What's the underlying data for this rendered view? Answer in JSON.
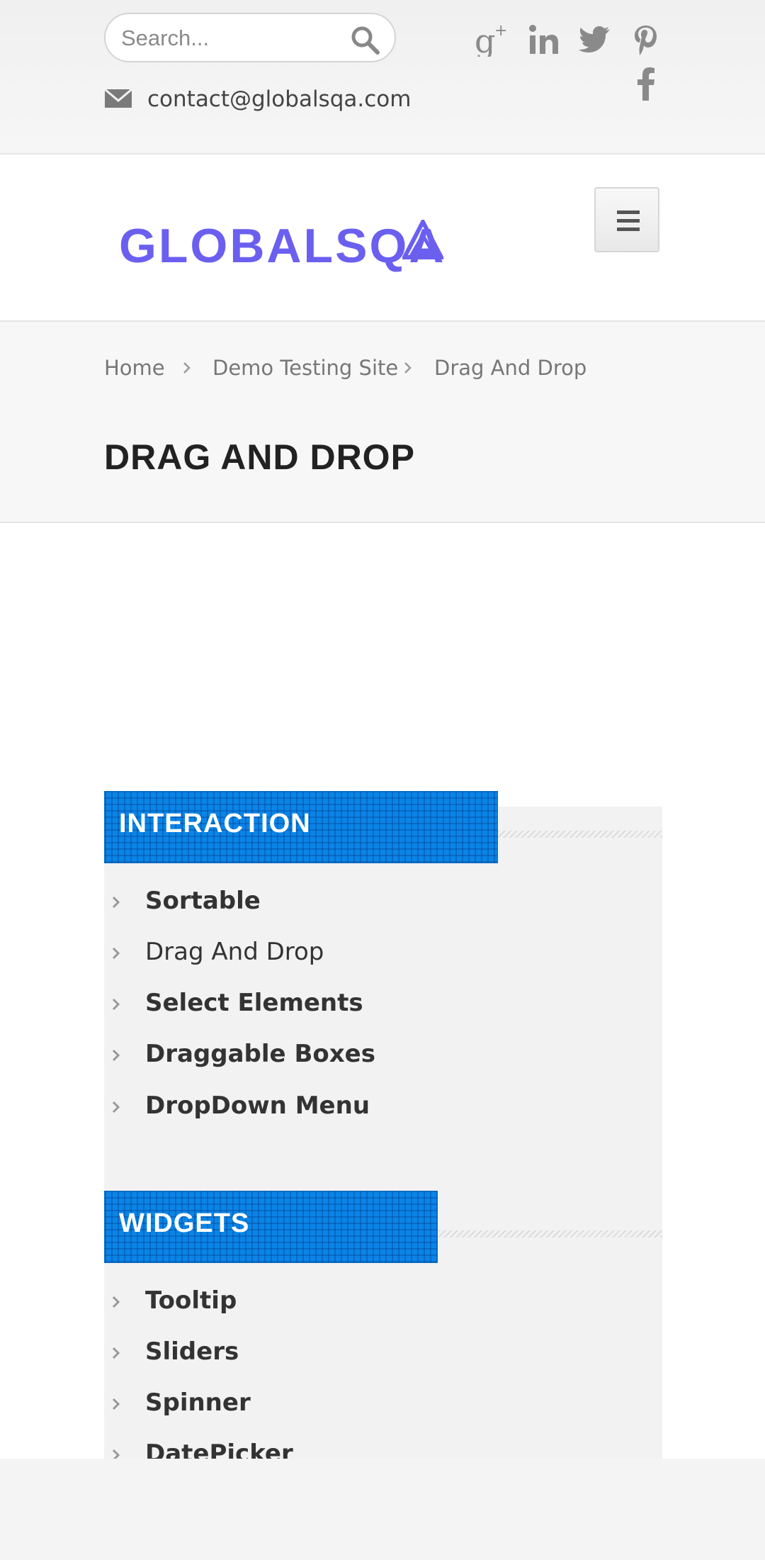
{
  "topbar": {
    "search_placeholder": "Search...",
    "contact_email": "contact@globalsqa.com",
    "social_icons": [
      "google-plus-icon",
      "linkedin-icon",
      "twitter-icon",
      "pinterest-icon",
      "facebook-icon"
    ]
  },
  "header": {
    "logo_text": "GLOBALSQA"
  },
  "breadcrumb": {
    "items": [
      "Home",
      "Demo Testing Site",
      "Drag And Drop"
    ]
  },
  "page": {
    "title": "DRAG AND DROP"
  },
  "sidebar": {
    "interaction": {
      "title": "INTERACTION",
      "items": [
        "Sortable",
        "Drag And Drop",
        "Select Elements",
        "Draggable Boxes",
        "DropDown Menu"
      ]
    },
    "widgets": {
      "title": "WIDGETS",
      "items": [
        "Tooltip",
        "Sliders",
        "Spinner",
        "DatePicker"
      ]
    }
  },
  "colors": {
    "accent_blue": "#0a84e6",
    "logo_purple": "#6b5ff0"
  }
}
